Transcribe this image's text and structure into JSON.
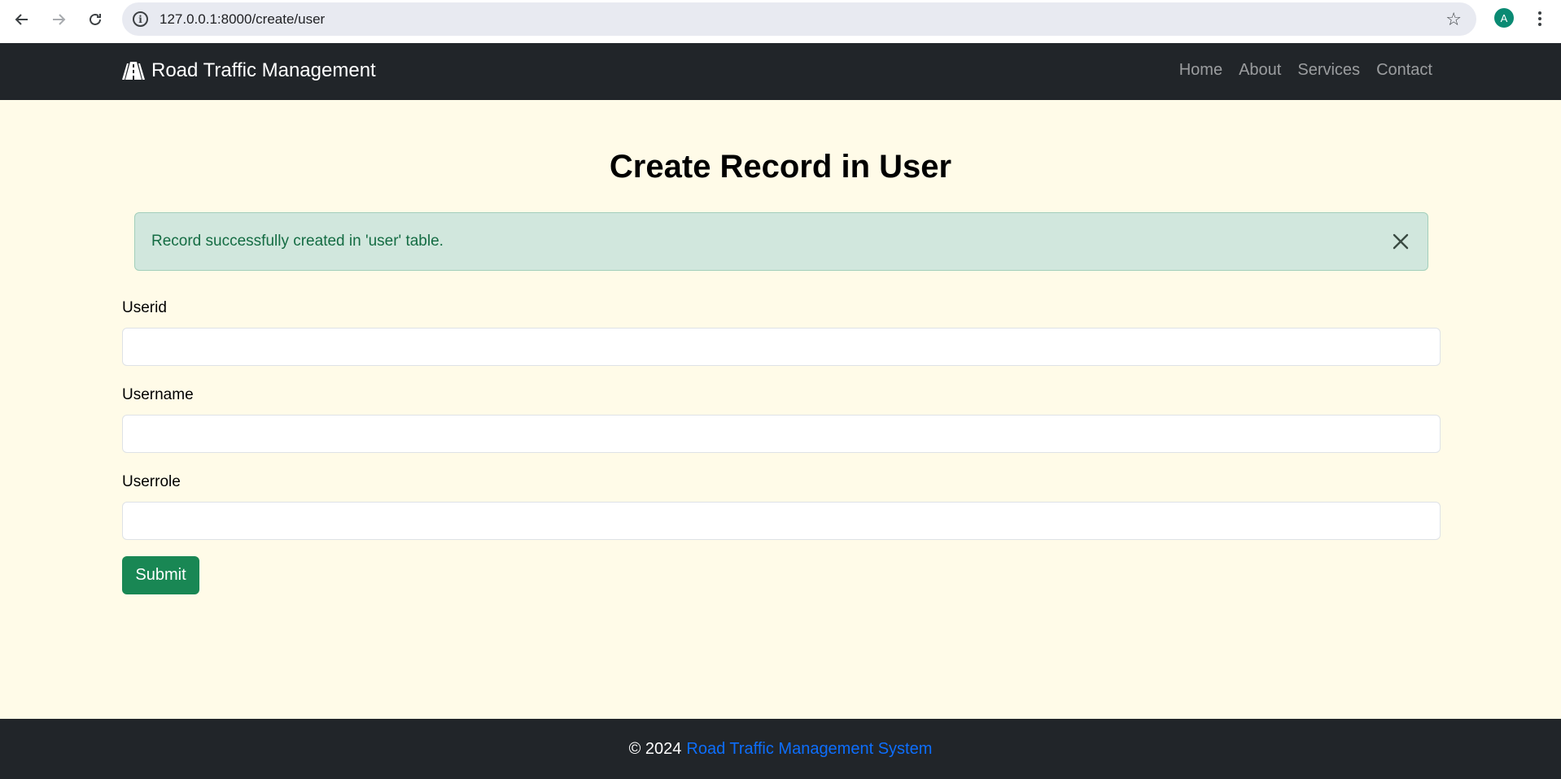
{
  "browser": {
    "url": "127.0.0.1:8000/create/user",
    "profile_initial": "A",
    "icons": [
      "back-arrow-icon",
      "forward-arrow-icon",
      "reload-icon",
      "info-icon",
      "star-icon",
      "kebab-menu-icon"
    ]
  },
  "navbar": {
    "brand": "Road Traffic Management",
    "brand_icon": "road-icon",
    "links": [
      "Home",
      "About",
      "Services",
      "Contact"
    ]
  },
  "main": {
    "title": "Create Record in User",
    "alert": {
      "message": "Record successfully created in 'user' table.",
      "color": "#d1e7dd"
    },
    "fields": [
      {
        "label": "Userid",
        "value": ""
      },
      {
        "label": "Username",
        "value": ""
      },
      {
        "label": "Userrole",
        "value": ""
      }
    ],
    "submit_label": "Submit",
    "submit_color": "#198754"
  },
  "footer": {
    "copyright": "© 2024",
    "link": "Road Traffic Management System"
  }
}
